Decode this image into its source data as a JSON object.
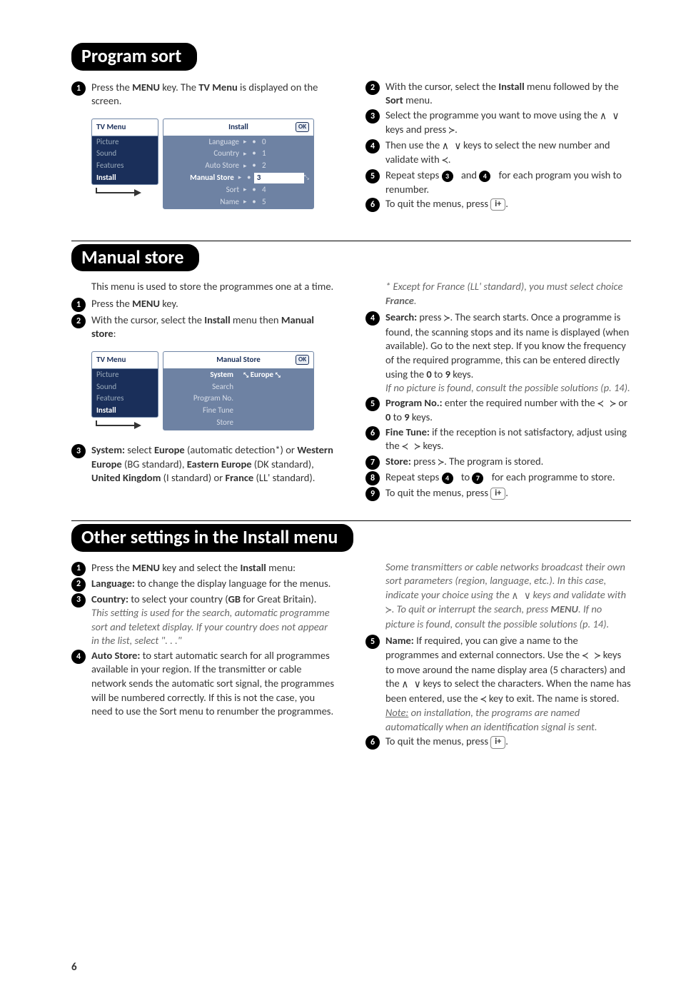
{
  "section1": {
    "title": "Program sort",
    "left": {
      "step1": "Press the <b>MENU</b> key. The <b>TV Menu</b> is displayed on the screen."
    },
    "right": {
      "step2": "With the cursor, select the <b>Install</b> menu followed by the <b>Sort</b> menu.",
      "step3_a": "Select the programme you want to move using the ",
      "step3_b": " keys and press ",
      "step3_c": ".",
      "step4_a": "Then use the ",
      "step4_b": " keys to select the new number and validate with ",
      "step4_c": ".",
      "step5_a": "Repeat steps ",
      "step5_b": " and ",
      "step5_c": " for each program you wish to renumber.",
      "step6_a": "To quit the menus, press ",
      "step6_b": "."
    },
    "menu": {
      "leftHeader": "TV Menu",
      "leftItems": [
        "Picture",
        "Sound",
        "Features",
        "Install"
      ],
      "rightHeader": "Install",
      "rows": [
        {
          "lab": "Language",
          "val": "0"
        },
        {
          "lab": "Country",
          "val": "1"
        },
        {
          "lab": "Auto Store",
          "val": "2"
        },
        {
          "lab": "Manual Store",
          "val": "3",
          "sel": true
        },
        {
          "lab": "Sort",
          "val": "4"
        },
        {
          "lab": "Name",
          "val": "5"
        }
      ]
    }
  },
  "section2": {
    "title": "Manual store",
    "left": {
      "intro": "This menu is used to store the programmes one at a time.",
      "step1": "Press the <b>MENU</b> key.",
      "step2": "With the cursor, select the <b>Install</b> menu then <b>Manual store</b>:",
      "step3": "<b>System:</b> select <b>Europe</b> (automatic detection*) or <b>Western Europe</b> (BG standard), <b>Eastern Europe</b> (DK standard), <b>United Kingdom</b> (I standard) or <b>France</b> (LL' standard)."
    },
    "right": {
      "note": "* Except for France (LL' standard), you must select choice <b>France</b>.",
      "step4": "<b>Search:</b> press <span class='arrow'>≻</span>. The search starts. Once a programme is found, the scanning stops and its name is displayed (when available). Go to the next step. If you know the frequency of the required programme, this can be entered directly using the <b>0</b> to <b>9</b> keys.",
      "step4_note": "If no picture is found, consult the possible solutions (p. 14).",
      "step5": "<b>Program No.:</b> enter the required number with the <span class='arrow'>≺ ≻</span> or <b>0</b> to <b>9</b> keys.",
      "step6": "<b>Fine Tune:</b> if the reception is not satisfactory, adjust using the <span class='arrow'>≺ ≻</span> keys.",
      "step7": "<b>Store:</b> press <span class='arrow'>≻</span>. The program is stored.",
      "step8_a": "Repeat steps ",
      "step8_b": " to ",
      "step8_c": " for each programme to store.",
      "step9_a": "To quit the menus, press ",
      "step9_b": "."
    },
    "menu": {
      "leftHeader": "TV Menu",
      "leftItems": [
        "Picture",
        "Sound",
        "Features",
        "Install"
      ],
      "rightHeader": "Manual Store",
      "rows": [
        {
          "lab": "System",
          "val": "Europe",
          "sel": true,
          "arrows": true
        },
        {
          "lab": "Search",
          "val": ""
        },
        {
          "lab": "Program No.",
          "val": ""
        },
        {
          "lab": "Fine Tune",
          "val": ""
        },
        {
          "lab": "Store",
          "val": ""
        }
      ]
    }
  },
  "section3": {
    "title": "Other settings in the Install menu",
    "left": {
      "step1": "Press the <b>MENU</b> key and select the <b>Install</b> menu:",
      "step2": "<b>Language:</b> to change the display language for the menus.",
      "step3": "<b>Country:</b> to select your country (<b>GB</b> for Great Britain).",
      "step3_note": "This setting is used for the search, automatic programme sort and teletext display. If your country does not appear in the list, select \". . .\"",
      "step4": "<b>Auto Store:</b> to start automatic search for all programmes available in your region. If the transmitter or cable network sends the automatic sort signal, the programmes will be numbered correctly. If this is not the case, you need to use the Sort menu to renumber the programmes."
    },
    "right": {
      "note": "Some transmitters or cable networks broadcast their own sort parameters (region, language, etc.). In this case, indicate your choice using the <span class='arrow'>∧ ∨</span> keys and validate with <span class='arrow'>≻</span>. To quit or interrupt the search, press <b>MENU</b>. If no picture is found, consult the possible solutions (p. 14).",
      "step5": "<b>Name:</b> If required, you can give a name to the programmes and external connectors. Use the <span class='arrow'>≺ ≻</span> keys to move around the name display area (5 characters) and the <span class='arrow'>∧ ∨</span> keys to select the characters. When the name has been entered, use the <span class='arrow'>≺</span> key to exit. The name is stored.",
      "step5_note": "<u>Note:</u> on installation, the programs are named automatically when an identification signal is sent.",
      "step6_a": "To quit the menus, press ",
      "step6_b": "."
    }
  },
  "pageNumber": "6",
  "glyphs": {
    "upDown": "∧ ∨",
    "right": "≻",
    "left": "≺",
    "info": "i+"
  }
}
